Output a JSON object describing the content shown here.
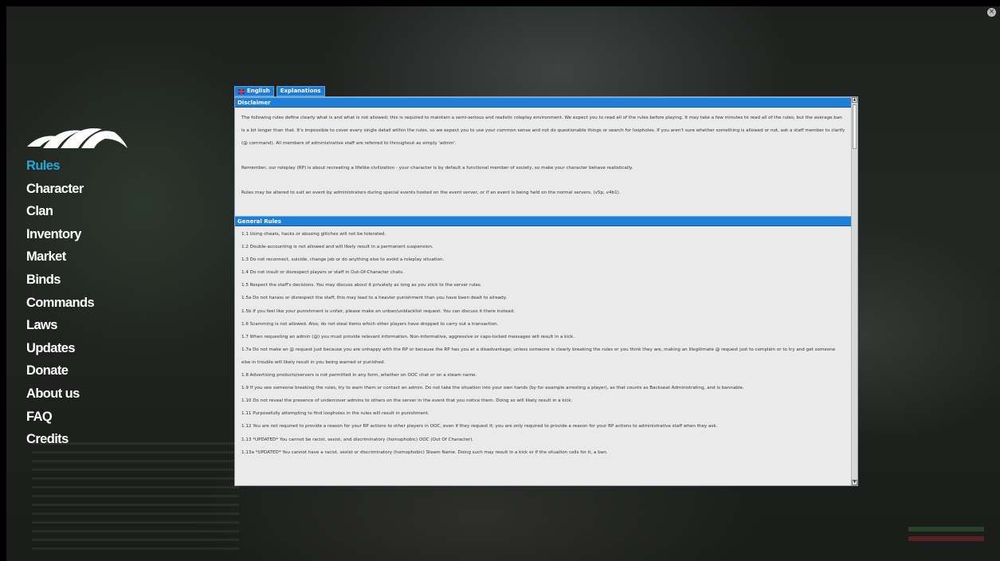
{
  "tabs": [
    {
      "label": "English",
      "icon": "uk-flag-icon"
    },
    {
      "label": "Explanations"
    }
  ],
  "nav": {
    "items": [
      "Rules",
      "Character",
      "Clan",
      "Inventory",
      "Market",
      "Binds",
      "Commands",
      "Laws",
      "Updates",
      "Donate",
      "About us",
      "FAQ",
      "Credits"
    ],
    "active": "Rules",
    "active_color": "#27a7d8"
  },
  "sections": {
    "disclaimer": {
      "title": "Disclaimer",
      "paragraphs": [
        "The following rules define clearly what is and what is not allowed; this is required to maintain a semi-serious and realistic roleplay environment. We expect you to read all of the rules before playing. It may take a few minutes to read all of the rules, but the average ban is a lot longer than that. It's impossible to cover every single detail within the rules, so we expect you to use your common sense and not do questionable things or search for loopholes. If you aren't sure whether something is allowed or not, ask a staff member to clarify (@ command). All members of administrative staff are referred to throughout as simply 'admin'.",
        "Remember, our roleplay (RP) is about recreating a lifelike civilization - your character is by default a functional member of society, so make your character behave realistically.",
        "Rules may be altered to suit an event by administrators during special events hosted on the event server, or if an event is being held on the normal servers. (v5p, v4b1)."
      ]
    },
    "general": {
      "title": "General Rules",
      "rules": [
        "1.1 Using cheats, hacks or abusing glitches will not be tolerated.",
        "1.2 Double-accounting is not allowed and will likely result in a permanent suspension.",
        "1.3 Do not reconnect, suicide, change job or do anything else to avoid a roleplay situation.",
        "1.4 Do not insult or disrespect players or staff in Out-Of-Character chats.",
        "1.5 Respect the staff's decisions. You may discuss about it privately as long as you stick to the server rules.",
        "1.5a Do not harass or disrespect the staff, this may lead to a heavier punishment than you have been dealt to already.",
        "1.5b If you feel like your punishment is unfair, please make an unban/unblacklist request. You can discuss it there instead.",
        "1.6 Scamming is not allowed. Also, do not steal items which other players have dropped to carry out a transaction.",
        "1.7 When requesting an admin (@) you must provide relevant information. Non-informative, aggressive or caps-locked messages will result in a kick.",
        "1.7a Do not make an @ request just because you are unhappy with the RP or because the RP has you at a disadvantage; unless someone is clearly breaking the rules or you think they are, making an illegitimate @ request just to complain or to try and get someone else in trouble will likely result in you being warned or punished.",
        "1.8 Advertising products/servers is not permitted in any form, whether on OOC chat or on a steam name.",
        "1.9 If you see someone breaking the rules, try to warn them or contact an admin. Do not take the situation into your own hands (by for example arresting a player), as that counts as Backseat Administrating, and is bannable.",
        "1.10 Do not reveal the presence of undercover admins to others on the server in the event that you notice them. Doing so will likely result in a kick.",
        "1.11 Purposefully attempting to find loopholes in the rules will result in punishment.",
        "1.12 You are not required to provide a reason for your RP actions to other players in OOC, even if they request it; you are only required to provide a reason for your RP actions to administrative staff when they ask.",
        "1.13 *UPDATED* You cannot be racist, sexist, and discriminatory (homophobic) OOC (Out Of Character).",
        "1.13a *UPDATED* You cannot have a racist, sexist or discriminatory (homophobic) Steam Name. Doing such may result in a kick or if the situation calls for it, a ban."
      ]
    }
  },
  "colors": {
    "header_blue": "#1f7fd6",
    "panel_bg": "#eaeaea",
    "nav_text": "#ffffff"
  }
}
